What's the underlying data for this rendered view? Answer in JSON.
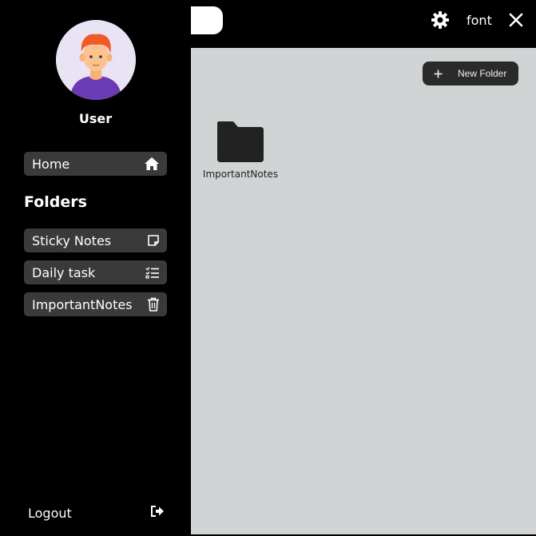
{
  "user": {
    "name": "User"
  },
  "sidebar": {
    "home_label": "Home",
    "folders_heading": "Folders",
    "folders": [
      {
        "label": "Sticky Notes",
        "icon": "sticky-note-icon"
      },
      {
        "label": "Daily task",
        "icon": "checklist-icon"
      },
      {
        "label": "ImportantNotes",
        "icon": "trash-icon"
      }
    ],
    "logout_label": "Logout"
  },
  "topbar": {
    "font_label": "font"
  },
  "main": {
    "new_folder_label": "New Folder",
    "folder_tiles": [
      {
        "name": "ImportantNotes"
      }
    ]
  },
  "colors": {
    "sidebar_bg": "#000000",
    "nav_item_bg": "#3a3a3a",
    "main_bg": "#d1d4d5",
    "button_bg": "#2a2a2a",
    "avatar_shirt": "#6a3bb5",
    "avatar_hair": "#f05a28"
  }
}
